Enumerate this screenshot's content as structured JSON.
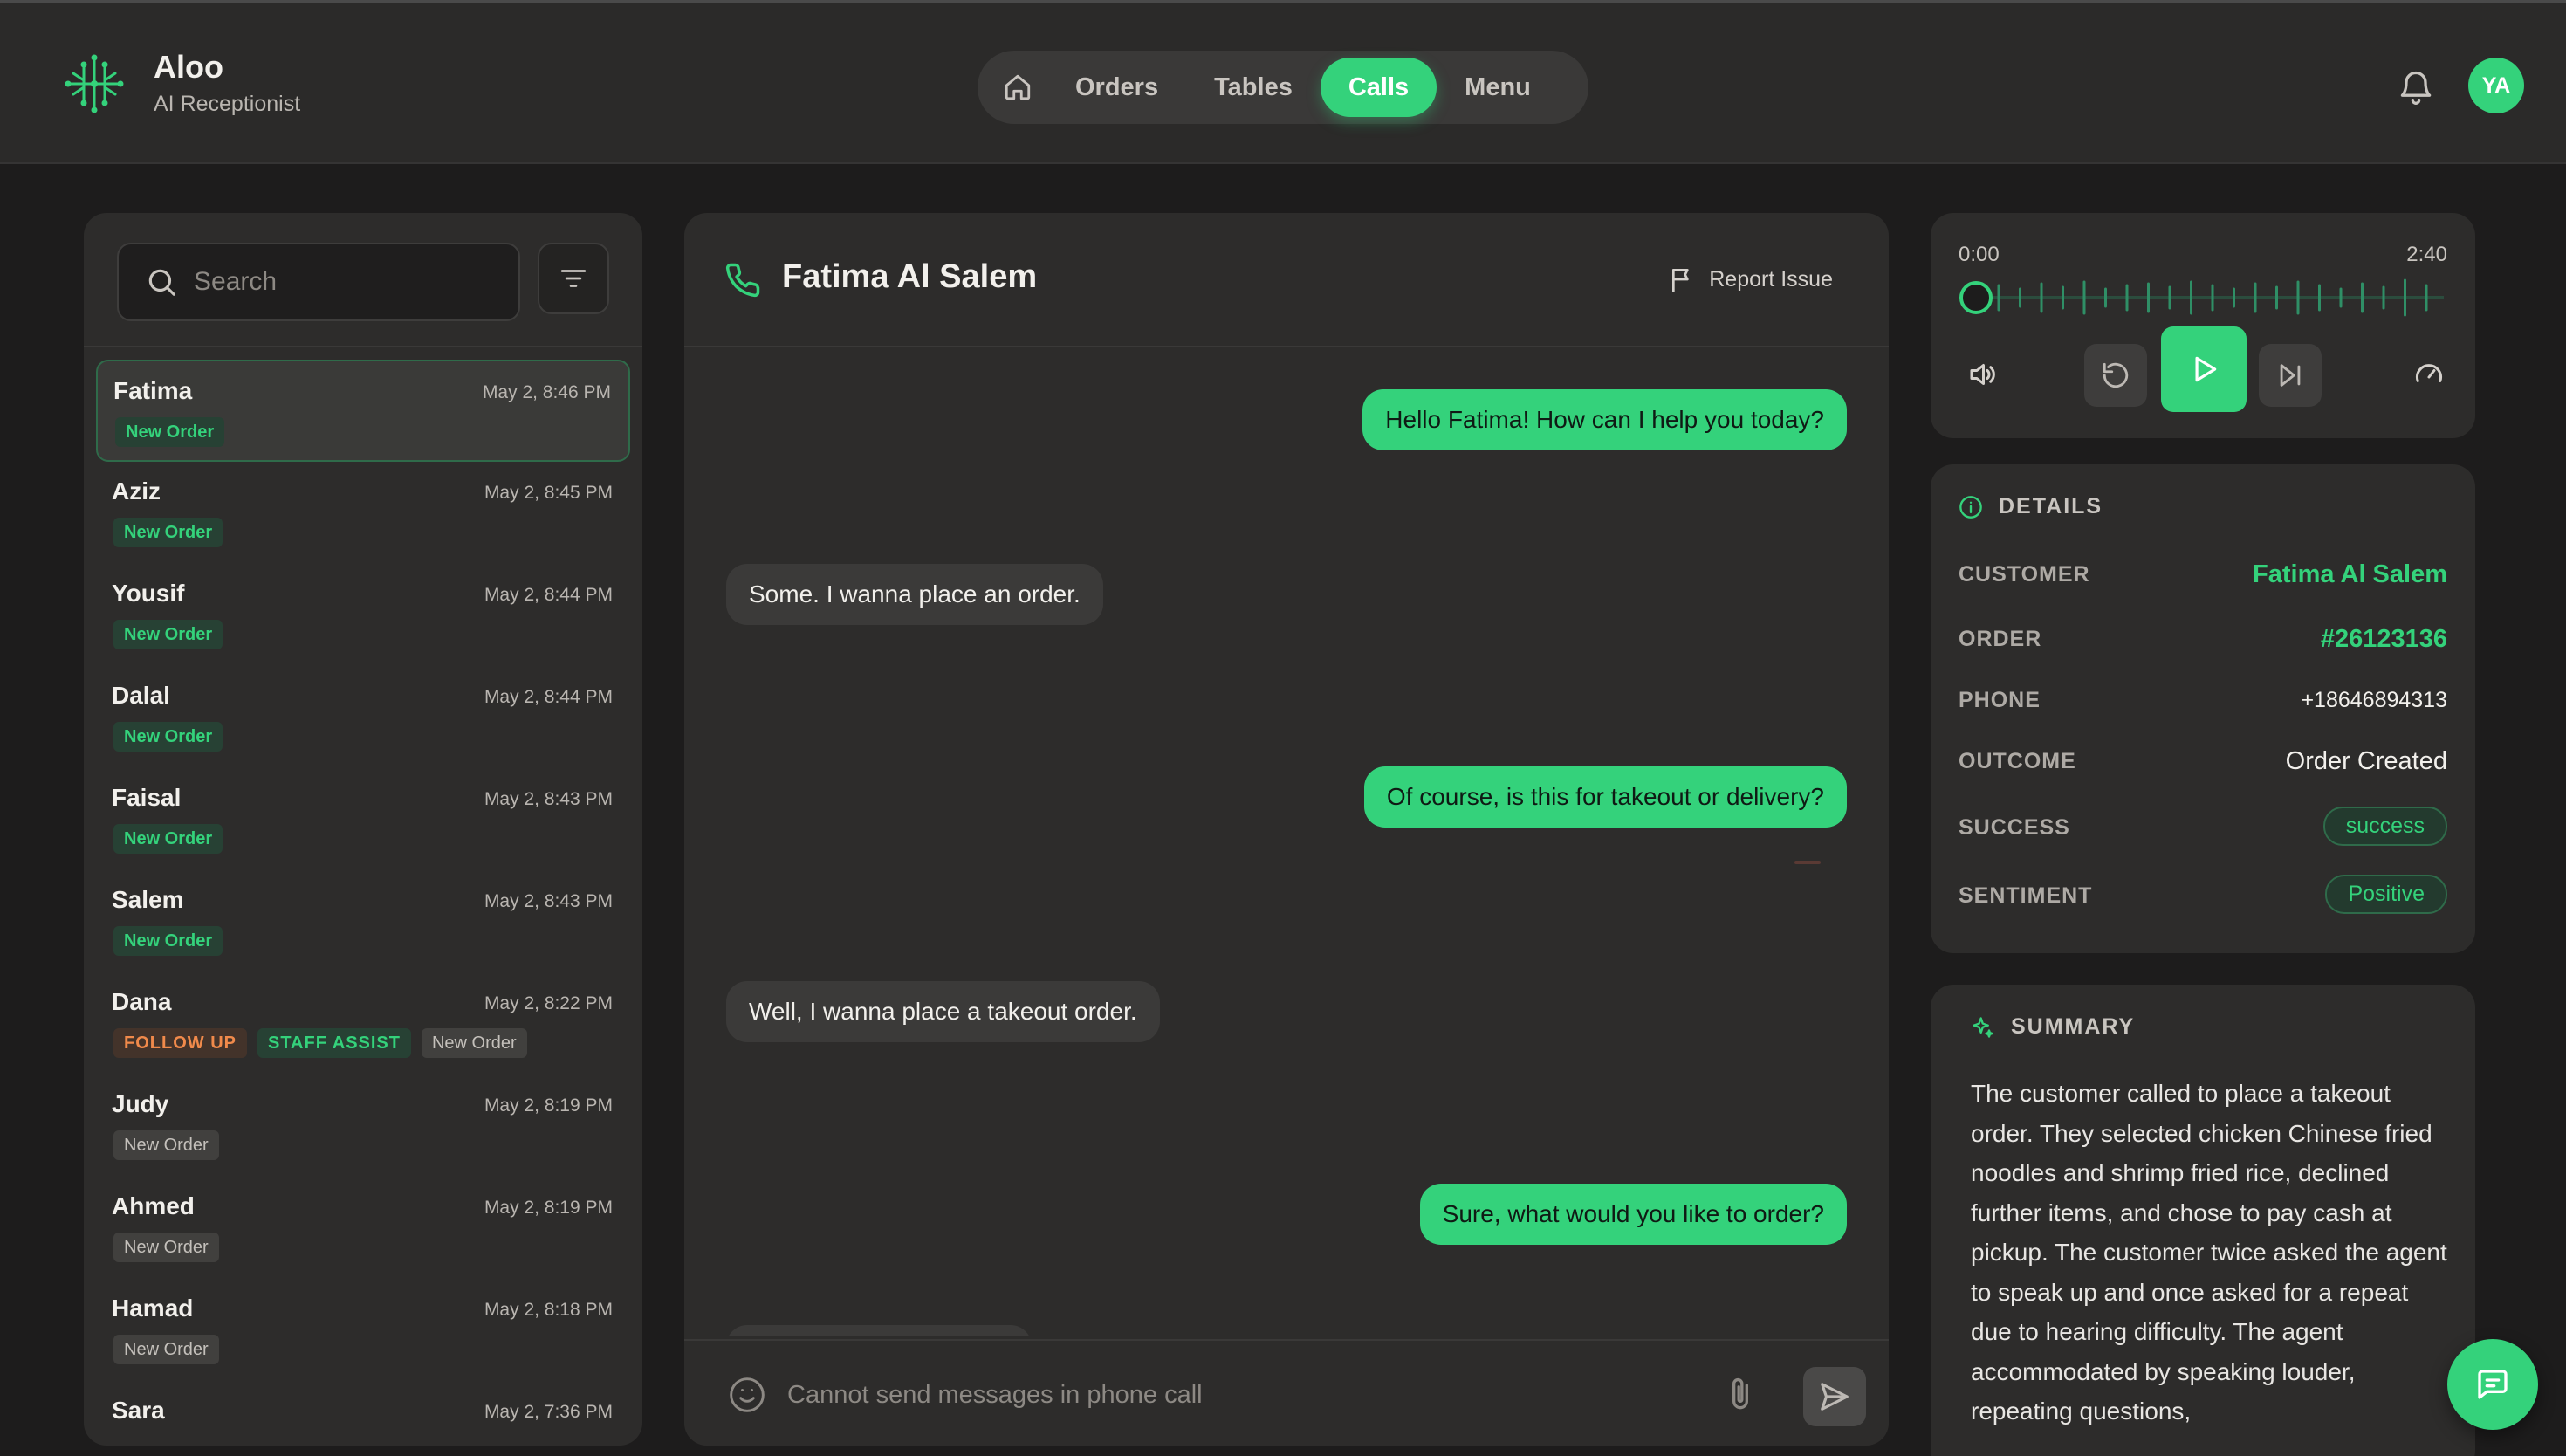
{
  "brand": {
    "name": "Aloo",
    "subtitle": "AI Receptionist",
    "icon": "neural-logo-icon"
  },
  "nav": {
    "items": [
      {
        "label": "",
        "icon": "home-icon"
      },
      {
        "label": "Orders"
      },
      {
        "label": "Tables"
      },
      {
        "label": "Calls",
        "active": true
      },
      {
        "label": "Menu"
      }
    ]
  },
  "user": {
    "initials": "YA"
  },
  "search": {
    "placeholder": "Search",
    "value": ""
  },
  "calls": [
    {
      "name": "Fatima",
      "time": "May 2, 8:46 PM",
      "tags": [
        "New Order"
      ],
      "selected": true
    },
    {
      "name": "Aziz",
      "time": "May 2, 8:45 PM",
      "tags": [
        "New Order"
      ]
    },
    {
      "name": "Yousif",
      "time": "May 2, 8:44 PM",
      "tags": [
        "New Order"
      ]
    },
    {
      "name": "Dalal",
      "time": "May 2, 8:44 PM",
      "tags": [
        "New Order"
      ]
    },
    {
      "name": "Faisal",
      "time": "May 2, 8:43 PM",
      "tags": [
        "New Order"
      ]
    },
    {
      "name": "Salem",
      "time": "May 2, 8:43 PM",
      "tags": [
        "New Order"
      ]
    },
    {
      "name": "Dana",
      "time": "May 2, 8:22 PM",
      "tags": [
        "FOLLOW UP",
        "STAFF ASSIST",
        "New Order"
      ]
    },
    {
      "name": "Judy",
      "time": "May 2, 8:19 PM",
      "tags": [
        "New Order"
      ]
    },
    {
      "name": "Ahmed",
      "time": "May 2, 8:19 PM",
      "tags": [
        "New Order"
      ]
    },
    {
      "name": "Hamad",
      "time": "May 2, 8:18 PM",
      "tags": [
        "New Order"
      ]
    },
    {
      "name": "Sara",
      "time": "May 2, 7:36 PM",
      "tags": []
    }
  ],
  "chat": {
    "title": "Fatima Al Salem",
    "report_label": "Report Issue",
    "messages": [
      {
        "from": "agent",
        "text": "Hello Fatima! How can I help you today?"
      },
      {
        "from": "customer",
        "text": "Some. I wanna place an order."
      },
      {
        "from": "agent",
        "text": "Of course, is this for takeout or delivery?"
      },
      {
        "from": "customer",
        "text": "Well, I wanna place a takeout order."
      },
      {
        "from": "agent",
        "text": "Sure, what would you like to order?"
      }
    ],
    "composer_placeholder": "Cannot send messages in phone call"
  },
  "player": {
    "current": "0:00",
    "duration": "2:40",
    "progress": 0
  },
  "details": {
    "heading": "DETAILS",
    "customer_label": "CUSTOMER",
    "customer": "Fatima Al Salem",
    "order_label": "ORDER",
    "order": "#26123136",
    "phone_label": "PHONE",
    "phone": "+18646894313",
    "outcome_label": "OUTCOME",
    "outcome": "Order Created",
    "success_label": "SUCCESS",
    "success": "success",
    "sentiment_label": "SENTIMENT",
    "sentiment": "Positive"
  },
  "summary": {
    "heading": "SUMMARY",
    "text": "The customer called to place a takeout order. They selected chicken Chinese fried noodles and shrimp fried rice, declined further items, and chose to pay cash at pickup. The customer twice asked the agent to speak up and once asked for a repeat due to hearing difficulty. The agent accommodated by speaking louder, repeating questions,"
  },
  "colors": {
    "accent": "#34d27b",
    "background": "#1d1c1c",
    "panel": "#2d2c2b",
    "warning": "#f08a4b"
  }
}
